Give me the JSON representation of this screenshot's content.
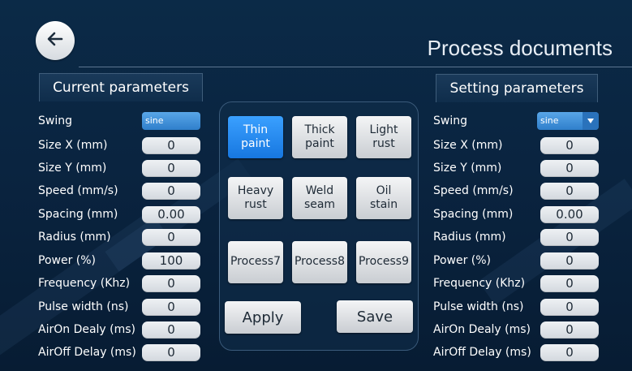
{
  "header": {
    "title": "Process documents"
  },
  "current": {
    "tab_label": "Current parameters",
    "swing": {
      "label": "Swing",
      "value": "sine"
    },
    "rows": [
      {
        "label": "Size X (mm)",
        "value": "0"
      },
      {
        "label": "Size Y (mm)",
        "value": "0"
      },
      {
        "label": "Speed (mm/s)",
        "value": "0"
      },
      {
        "label": "Spacing (mm)",
        "value": "0.00"
      },
      {
        "label": "Radius (mm)",
        "value": "0"
      },
      {
        "label": "Power (%)",
        "value": "100"
      },
      {
        "label": "Frequency (Khz)",
        "value": "0"
      },
      {
        "label": "Pulse width (ns)",
        "value": "0"
      },
      {
        "label": "AirOn Dealy (ms)",
        "value": "0"
      },
      {
        "label": "AirOff Delay (ms)",
        "value": "0"
      }
    ]
  },
  "setting": {
    "tab_label": "Setting parameters",
    "swing": {
      "label": "Swing",
      "value": "sine"
    },
    "rows": [
      {
        "label": "Size X (mm)",
        "value": "0"
      },
      {
        "label": "Size Y (mm)",
        "value": "0"
      },
      {
        "label": "Speed (mm/s)",
        "value": "0"
      },
      {
        "label": "Spacing (mm)",
        "value": "0.00"
      },
      {
        "label": "Radius (mm)",
        "value": "0"
      },
      {
        "label": "Power (%)",
        "value": "0"
      },
      {
        "label": "Frequency (Khz)",
        "value": "0"
      },
      {
        "label": "Pulse width (ns)",
        "value": "0"
      },
      {
        "label": "AirOn Dealy (ms)",
        "value": "0"
      },
      {
        "label": "AirOff Delay (ms)",
        "value": "0"
      }
    ]
  },
  "processes": [
    {
      "line1": "Thin",
      "line2": "paint",
      "selected": true
    },
    {
      "line1": "Thick",
      "line2": "paint",
      "selected": false
    },
    {
      "line1": "Light",
      "line2": "rust",
      "selected": false
    },
    {
      "line1": "Heavy",
      "line2": "rust",
      "selected": false
    },
    {
      "line1": "Weld",
      "line2": "seam",
      "selected": false
    },
    {
      "line1": "Oil",
      "line2": "stain",
      "selected": false
    },
    {
      "line1": "Process7",
      "line2": "",
      "selected": false
    },
    {
      "line1": "Process8",
      "line2": "",
      "selected": false
    },
    {
      "line1": "Process9",
      "line2": "",
      "selected": false
    }
  ],
  "actions": {
    "apply_label": "Apply",
    "save_label": "Save"
  },
  "icons": {
    "back": "arrow-left-icon",
    "dropdown": "caret-down-icon"
  },
  "colors": {
    "accent": "#2a8cf0",
    "background": "#0b2a47",
    "field": "#e3e7eb"
  }
}
